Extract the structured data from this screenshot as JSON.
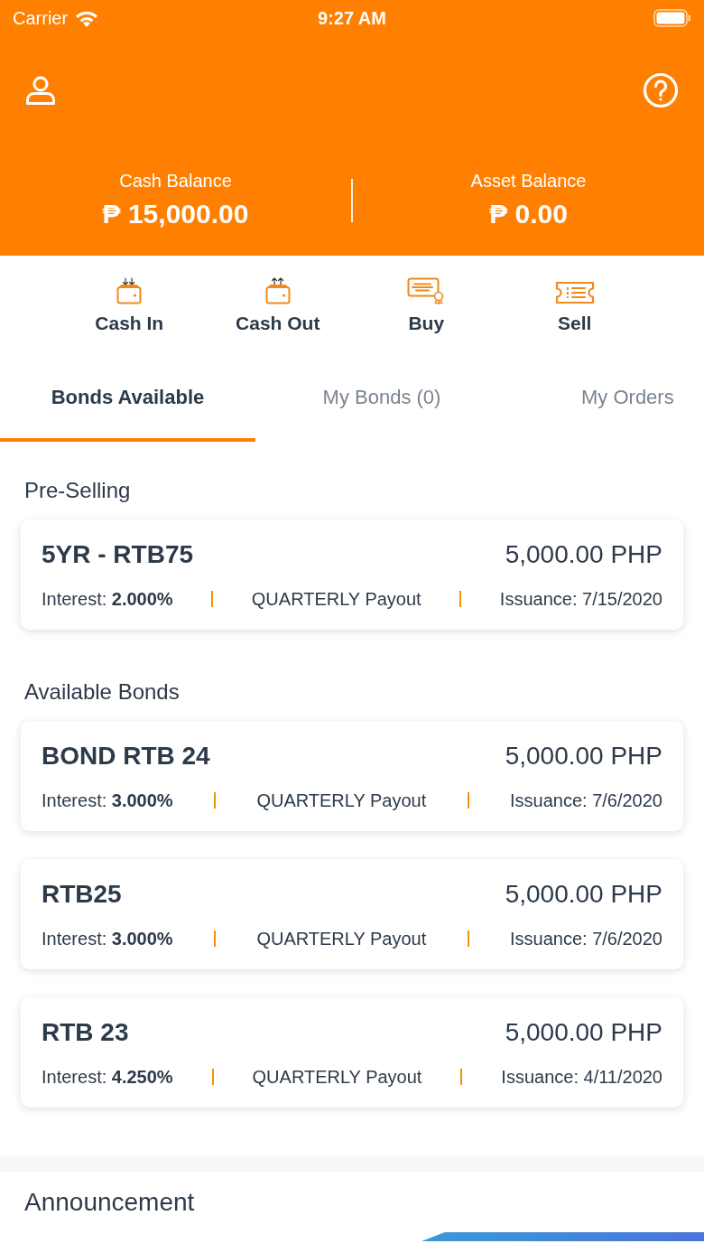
{
  "status_bar": {
    "carrier": "Carrier",
    "time": "9:27 AM"
  },
  "balances": [
    {
      "label": "Cash Balance",
      "amount": "₱ 15,000.00"
    },
    {
      "label": "Asset Balance",
      "amount": "₱ 0.00"
    }
  ],
  "actions": [
    {
      "kind": "cash_in",
      "label": "Cash In"
    },
    {
      "kind": "cash_out",
      "label": "Cash Out"
    },
    {
      "kind": "buy",
      "label": "Buy"
    },
    {
      "kind": "sell",
      "label": "Sell"
    }
  ],
  "tabs": [
    {
      "label": "Bonds Available",
      "selected": true
    },
    {
      "label": "My Bonds (0)",
      "selected": false
    },
    {
      "label": "My Orders",
      "selected": false
    }
  ],
  "sections": [
    {
      "title": "Pre-Selling",
      "bonds": [
        {
          "name": "5YR - RTB75",
          "price": "5,000.00 PHP",
          "interest": "Interest: **2.000%**",
          "payout": "QUARTERLY Payout",
          "issuance": "Issuance: 7/15/2020"
        }
      ]
    },
    {
      "title": "Available Bonds",
      "bonds": [
        {
          "name": "BOND RTB 24",
          "price": "5,000.00 PHP",
          "interest": "Interest: **3.000%**",
          "payout": "QUARTERLY Payout",
          "issuance": "Issuance: 7/6/2020"
        },
        {
          "name": "RTB25",
          "price": "5,000.00 PHP",
          "interest": "Interest: **3.000%**",
          "payout": "QUARTERLY Payout",
          "issuance": "Issuance: 7/6/2020"
        },
        {
          "name": "RTB 23",
          "price": "5,000.00 PHP",
          "interest": "Interest: **4.250%**",
          "payout": "QUARTERLY Payout",
          "issuance": "Issuance: 4/11/2020"
        }
      ]
    }
  ],
  "announcement": {
    "title": "Announcement"
  }
}
